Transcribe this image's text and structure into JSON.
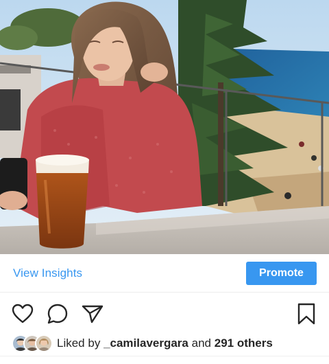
{
  "post": {
    "image_alt": "Woman in red knit sweater with a glass of beer on a balcony overlooking the beach"
  },
  "insights_bar": {
    "view_insights_label": "View Insights",
    "promote_label": "Promote"
  },
  "actions": {
    "like_icon": "heart-icon",
    "comment_icon": "comment-icon",
    "share_icon": "send-icon",
    "save_icon": "bookmark-icon"
  },
  "likes": {
    "prefix": "Liked by",
    "user": "_camilavergara",
    "connector": "and",
    "others": "291 others"
  },
  "colors": {
    "accent": "#3897f0",
    "text": "#262626"
  }
}
